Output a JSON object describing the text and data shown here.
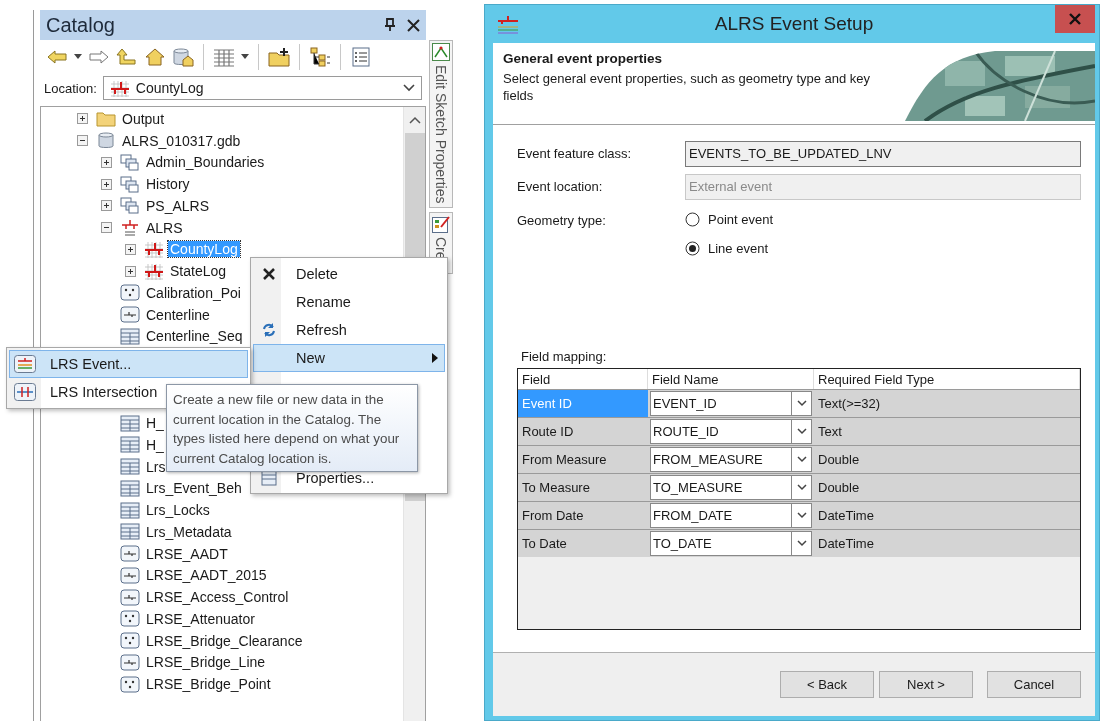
{
  "catalog": {
    "title": "Catalog",
    "location_label": "Location:",
    "location_value": "CountyLog",
    "side_tabs": [
      {
        "label": "Edit Sketch Properties",
        "kind": "sketch"
      },
      {
        "label": "Cre",
        "kind": "template"
      }
    ],
    "tree": {
      "items": [
        {
          "label": "Output",
          "kind": "folder",
          "expanded": false,
          "selected": false
        },
        {
          "label": "ALRS_010317.gdb",
          "kind": "gdb",
          "expanded": true,
          "selected": false,
          "children": [
            {
              "label": "Admin_Boundaries",
              "kind": "dataset",
              "expanded": false,
              "selected": false
            },
            {
              "label": "History",
              "kind": "dataset",
              "expanded": false,
              "selected": false
            },
            {
              "label": "PS_ALRS",
              "kind": "dataset",
              "expanded": false,
              "selected": false
            },
            {
              "label": "ALRS",
              "kind": "lrs",
              "expanded": true,
              "selected": false,
              "children": [
                {
                  "label": "CountyLog",
                  "kind": "network",
                  "expanded": false,
                  "selected": true
                },
                {
                  "label": "StateLog",
                  "kind": "network",
                  "expanded": false,
                  "selected": false
                }
              ]
            },
            {
              "label": "Calibration_Poi",
              "kind": "point",
              "selected": false
            },
            {
              "label": "Centerline",
              "kind": "line",
              "selected": false
            },
            {
              "label": "Centerline_Seq",
              "kind": "table",
              "selected": false
            }
          ]
        }
      ],
      "items_below_menu": [
        {
          "label": "H_",
          "kind": "table",
          "selected": false
        },
        {
          "label": "H_",
          "kind": "table",
          "selected": false
        },
        {
          "label": "Lrs",
          "kind": "table",
          "selected": false
        },
        {
          "label": "Lrs_Event_Beh",
          "kind": "table",
          "selected": false
        },
        {
          "label": "Lrs_Locks",
          "kind": "table",
          "selected": false
        },
        {
          "label": "Lrs_Metadata",
          "kind": "table",
          "selected": false
        },
        {
          "label": "LRSE_AADT",
          "kind": "line",
          "selected": false
        },
        {
          "label": "LRSE_AADT_2015",
          "kind": "line",
          "selected": false
        },
        {
          "label": "LRSE_Access_Control",
          "kind": "line",
          "selected": false
        },
        {
          "label": "LRSE_Attenuator",
          "kind": "point",
          "selected": false
        },
        {
          "label": "LRSE_Bridge_Clearance",
          "kind": "point",
          "selected": false
        },
        {
          "label": "LRSE_Bridge_Line",
          "kind": "line",
          "selected": false
        },
        {
          "label": "LRSE_Bridge_Point",
          "kind": "point",
          "selected": false
        }
      ]
    }
  },
  "context_menu": {
    "items": [
      {
        "label": "Delete",
        "kind": "delete",
        "selected": false
      },
      {
        "label": "Rename",
        "kind": "rename",
        "selected": false
      },
      {
        "label": "Refresh",
        "kind": "refresh",
        "selected": false
      },
      {
        "label": "New",
        "kind": "new",
        "selected": true,
        "submenu": true
      }
    ],
    "items_below_tooltip": [
      {
        "label": "Properties...",
        "kind": "properties",
        "selected": false
      }
    ]
  },
  "submenu": {
    "items": [
      {
        "label": "LRS Event...",
        "kind": "event",
        "selected": true
      },
      {
        "label": "LRS Intersection",
        "kind": "intersection",
        "selected": false
      }
    ]
  },
  "tooltip": {
    "text": "Create a new file or new data in the current location in the Catalog. The types listed here depend on what your current Catalog location is."
  },
  "dialog": {
    "title": "ALRS Event Setup",
    "header_title": "General event properties",
    "header_text": "Select general event properties, such as geometry type and key fields",
    "fields": [
      {
        "label": "Event feature class:",
        "value": "EVENTS_TO_BE_UPDATED_LNV",
        "disabled": false
      },
      {
        "label": "Event location:",
        "value": "External event",
        "disabled": true
      }
    ],
    "geometry_label": "Geometry type:",
    "geometry_options": [
      {
        "label": "Point event",
        "selected": false
      },
      {
        "label": "Line event",
        "selected": true
      }
    ],
    "mapping_label": "Field mapping:",
    "table": {
      "columns": [
        "Field",
        "Field Name",
        "Required Field Type"
      ],
      "rows": [
        {
          "field": "Event ID",
          "field_name": "EVENT_ID",
          "type": "Text(>=32)",
          "selected": true
        },
        {
          "field": "Route ID",
          "field_name": "ROUTE_ID",
          "type": "Text",
          "selected": false
        },
        {
          "field": "From Measure",
          "field_name": "FROM_MEASURE",
          "type": "Double",
          "selected": false
        },
        {
          "field": "To Measure",
          "field_name": "TO_MEASURE",
          "type": "Double",
          "selected": false
        },
        {
          "field": "From Date",
          "field_name": "FROM_DATE",
          "type": "DateTime",
          "selected": false
        },
        {
          "field": "To Date",
          "field_name": "TO_DATE",
          "type": "DateTime",
          "selected": false
        }
      ]
    },
    "buttons": [
      "< Back",
      "Next >",
      "Cancel"
    ]
  }
}
